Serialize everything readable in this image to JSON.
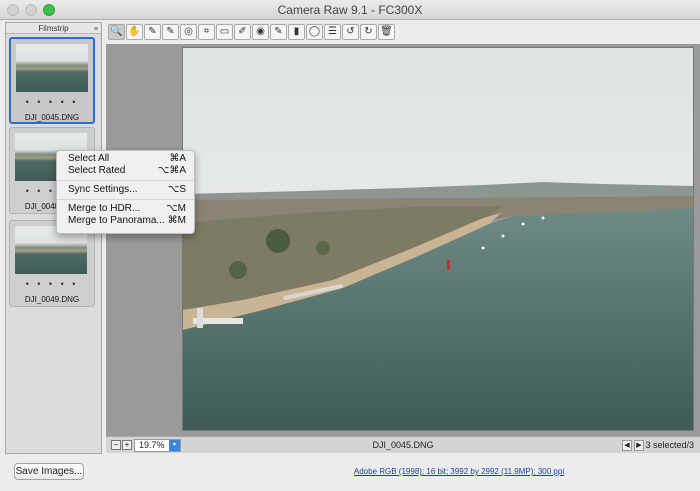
{
  "window": {
    "title": "Camera Raw 9.1  -  FC300X"
  },
  "filmstrip": {
    "header": "Filmstrip",
    "items": [
      {
        "name": "DJI_0045.DNG",
        "rating": "• • • • •"
      },
      {
        "name": "DJI_0048.DNG",
        "rating": "• • • • •"
      },
      {
        "name": "DJI_0049.DNG",
        "rating": "• • • • •"
      }
    ]
  },
  "toolbar": {
    "tools": [
      "zoom-tool",
      "hand-tool",
      "white-balance-tool",
      "color-sampler-tool",
      "targeted-adjustment-tool",
      "crop-tool",
      "straighten-tool",
      "spot-removal-tool",
      "red-eye-removal-tool",
      "adjustment-brush-tool",
      "graduated-filter-tool",
      "radial-filter-tool",
      "preferences-tool",
      "rotate-left-tool",
      "rotate-right-tool",
      "trash-tool"
    ]
  },
  "status": {
    "zoom_value": "19.7%",
    "current_file": "DJI_0045.DNG",
    "selection": "3 selected/3"
  },
  "context_menu": {
    "items": [
      {
        "label": "Select All",
        "shortcut": "⌘A"
      },
      {
        "label": "Select Rated",
        "shortcut": "⌥⌘A"
      },
      {
        "label": "Sync Settings...",
        "shortcut": "⌥S"
      },
      {
        "label": "Merge to HDR...",
        "shortcut": "⌥M"
      },
      {
        "label": "Merge to Panorama...",
        "shortcut": "⌘M"
      }
    ]
  },
  "bottom": {
    "save_label": "Save Images...",
    "workflow_link": "Adobe RGB (1998); 16 bit; 3992 by 2992 (11.9MP); 300 ppi"
  },
  "colors": {
    "accent": "#2d6fd1",
    "link": "#1a3eb6",
    "traffic_green": "#3fbf4a"
  }
}
